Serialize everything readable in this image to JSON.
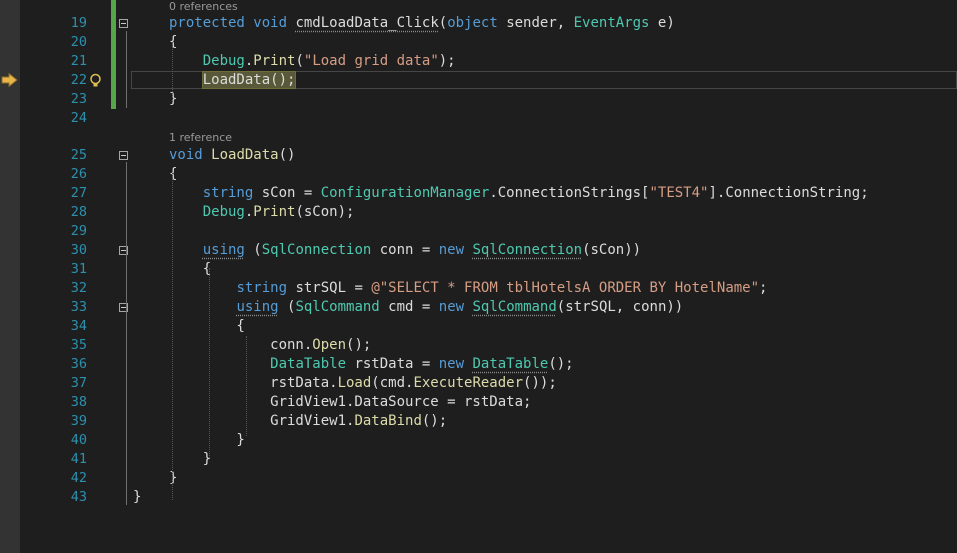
{
  "codelens": [
    {
      "text": "0 references"
    },
    {
      "text": "1 reference"
    }
  ],
  "lines": [
    {
      "num": "19",
      "tokens": [
        {
          "t": "protected",
          "c": "kw"
        },
        {
          "t": " ",
          "c": "pl"
        },
        {
          "t": "void",
          "c": "kw"
        },
        {
          "t": " ",
          "c": "pl"
        },
        {
          "t": "cmdLoadData_Click",
          "c": "pl",
          "u": 1
        },
        {
          "t": "(",
          "c": "pl"
        },
        {
          "t": "object",
          "c": "kw"
        },
        {
          "t": " sender, ",
          "c": "pl"
        },
        {
          "t": "EventArgs",
          "c": "ty"
        },
        {
          "t": " e)",
          "c": "pl"
        }
      ]
    },
    {
      "num": "20",
      "tokens": [
        {
          "t": "{",
          "c": "pl"
        }
      ]
    },
    {
      "num": "21",
      "tokens": [
        {
          "t": "    Debug",
          "c": "ty"
        },
        {
          "t": ".",
          "c": "pl"
        },
        {
          "t": "Print",
          "c": "me"
        },
        {
          "t": "(",
          "c": "pl"
        },
        {
          "t": "\"Load grid data\"",
          "c": "st"
        },
        {
          "t": ");",
          "c": "pl"
        }
      ]
    },
    {
      "num": "22",
      "tokens": [
        {
          "t": "    ",
          "c": "pl"
        },
        {
          "t": "LoadData();",
          "c": "pl",
          "hl": 1
        }
      ]
    },
    {
      "num": "23",
      "tokens": [
        {
          "t": "}",
          "c": "pl"
        }
      ]
    },
    {
      "num": "24",
      "tokens": []
    },
    {
      "num": "25",
      "tokens": [
        {
          "t": "void",
          "c": "kw"
        },
        {
          "t": " ",
          "c": "pl"
        },
        {
          "t": "LoadData",
          "c": "me"
        },
        {
          "t": "()",
          "c": "pl"
        }
      ]
    },
    {
      "num": "26",
      "tokens": [
        {
          "t": "{",
          "c": "pl"
        }
      ]
    },
    {
      "num": "27",
      "tokens": [
        {
          "t": "    ",
          "c": "pl"
        },
        {
          "t": "string",
          "c": "kw"
        },
        {
          "t": " sCon = ",
          "c": "pl"
        },
        {
          "t": "ConfigurationManager",
          "c": "ty"
        },
        {
          "t": ".ConnectionStrings[",
          "c": "pl"
        },
        {
          "t": "\"TEST4\"",
          "c": "st"
        },
        {
          "t": "].ConnectionString;",
          "c": "pl"
        }
      ]
    },
    {
      "num": "28",
      "tokens": [
        {
          "t": "    Debug",
          "c": "ty"
        },
        {
          "t": ".",
          "c": "pl"
        },
        {
          "t": "Print",
          "c": "me"
        },
        {
          "t": "(sCon);",
          "c": "pl"
        }
      ]
    },
    {
      "num": "29",
      "tokens": []
    },
    {
      "num": "30",
      "tokens": [
        {
          "t": "    ",
          "c": "pl"
        },
        {
          "t": "using",
          "c": "kw",
          "u": 1
        },
        {
          "t": " (",
          "c": "pl"
        },
        {
          "t": "SqlConnection",
          "c": "ty"
        },
        {
          "t": " conn = ",
          "c": "pl"
        },
        {
          "t": "new",
          "c": "kw"
        },
        {
          "t": " ",
          "c": "pl"
        },
        {
          "t": "SqlConnection",
          "c": "ty",
          "u": 1
        },
        {
          "t": "(sCon))",
          "c": "pl"
        }
      ]
    },
    {
      "num": "31",
      "tokens": [
        {
          "t": "    {",
          "c": "pl"
        }
      ]
    },
    {
      "num": "32",
      "tokens": [
        {
          "t": "        ",
          "c": "pl"
        },
        {
          "t": "string",
          "c": "kw"
        },
        {
          "t": " strSQL = ",
          "c": "pl"
        },
        {
          "t": "@\"SELECT * FROM tblHotelsA ORDER BY HotelName\"",
          "c": "st"
        },
        {
          "t": ";",
          "c": "pl"
        }
      ]
    },
    {
      "num": "33",
      "tokens": [
        {
          "t": "        ",
          "c": "pl"
        },
        {
          "t": "using",
          "c": "kw",
          "u": 1
        },
        {
          "t": " (",
          "c": "pl"
        },
        {
          "t": "SqlCommand",
          "c": "ty"
        },
        {
          "t": " cmd = ",
          "c": "pl"
        },
        {
          "t": "new",
          "c": "kw"
        },
        {
          "t": " ",
          "c": "pl"
        },
        {
          "t": "SqlCommand",
          "c": "ty",
          "u": 1
        },
        {
          "t": "(strSQL, conn))",
          "c": "pl"
        }
      ]
    },
    {
      "num": "34",
      "tokens": [
        {
          "t": "        {",
          "c": "pl"
        }
      ]
    },
    {
      "num": "35",
      "tokens": [
        {
          "t": "            conn.",
          "c": "pl"
        },
        {
          "t": "Open",
          "c": "me"
        },
        {
          "t": "();",
          "c": "pl"
        }
      ]
    },
    {
      "num": "36",
      "tokens": [
        {
          "t": "            ",
          "c": "pl"
        },
        {
          "t": "DataTable",
          "c": "ty"
        },
        {
          "t": " rstData = ",
          "c": "pl"
        },
        {
          "t": "new",
          "c": "kw"
        },
        {
          "t": " ",
          "c": "pl"
        },
        {
          "t": "DataTable",
          "c": "ty",
          "u": 1
        },
        {
          "t": "();",
          "c": "pl"
        }
      ]
    },
    {
      "num": "37",
      "tokens": [
        {
          "t": "            rstData.",
          "c": "pl"
        },
        {
          "t": "Load",
          "c": "me"
        },
        {
          "t": "(cmd.",
          "c": "pl"
        },
        {
          "t": "ExecuteReader",
          "c": "me"
        },
        {
          "t": "());",
          "c": "pl"
        }
      ]
    },
    {
      "num": "38",
      "tokens": [
        {
          "t": "            GridView1.DataSource = rstData;",
          "c": "pl"
        }
      ]
    },
    {
      "num": "39",
      "tokens": [
        {
          "t": "            GridView1.",
          "c": "pl"
        },
        {
          "t": "DataBind",
          "c": "me"
        },
        {
          "t": "();",
          "c": "pl"
        }
      ]
    },
    {
      "num": "40",
      "tokens": [
        {
          "t": "        }",
          "c": "pl"
        }
      ]
    },
    {
      "num": "41",
      "tokens": [
        {
          "t": "    }",
          "c": "pl"
        }
      ]
    },
    {
      "num": "42",
      "tokens": [
        {
          "t": "}",
          "c": "pl"
        }
      ]
    },
    {
      "num": "43",
      "tokens": [
        {
          "t": "}",
          "c": "pl",
          "pre": -36
        }
      ]
    }
  ],
  "colors": {
    "background": "#1e1e1e",
    "keyword": "#569cd6",
    "type": "#4ec9b0",
    "string": "#d69d85",
    "method": "#dcdcaa",
    "line_number": "#2b91af",
    "change_bar": "#57a64a"
  },
  "icons": {
    "exec_arrow": "execution-pointer-arrow-icon",
    "bulb": "lightbulb-icon",
    "fold": "collapse-minus-icon"
  }
}
